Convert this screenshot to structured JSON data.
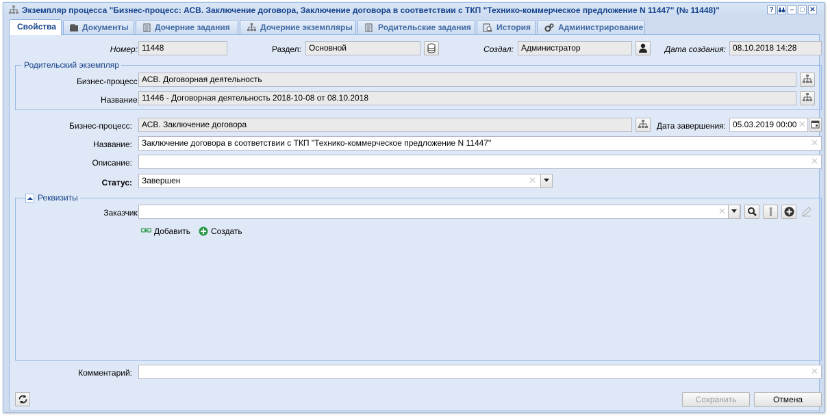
{
  "window": {
    "title": "Экземпляр процесса \"Бизнес-процесс: АСВ. Заключение договора, Заключение договора в соответствии с ТКП \"Технико-коммерческое предложение N 11447\" (№ 11448)\"",
    "buttons": [
      "?",
      "⚲",
      "–",
      "□",
      "✕"
    ]
  },
  "tabs": [
    {
      "label": "Свойства",
      "icon": "none"
    },
    {
      "label": "Документы",
      "icon": "documents-icon"
    },
    {
      "label": "Дочерние задания",
      "icon": "task-icon"
    },
    {
      "label": "Дочерние экземпляры",
      "icon": "process-icon"
    },
    {
      "label": "Родительские задания",
      "icon": "task-icon"
    },
    {
      "label": "История",
      "icon": "history-icon"
    },
    {
      "label": "Администрирование",
      "icon": "gear-icon"
    }
  ],
  "header": {
    "number_label": "Номер:",
    "number_value": "11448",
    "section_label": "Раздел:",
    "section_value": "Основной",
    "created_by_label": "Создал:",
    "created_by_value": "Администратор",
    "created_date_label": "Дата создания:",
    "created_date_value": "08.10.2018 14:28"
  },
  "parent": {
    "legend": "Родительский экземпляр",
    "bp_label": "Бизнес-процесс:",
    "bp_value": "АСВ. Договорная деятельность",
    "name_label": "Название:",
    "name_value": "11446 - Договорная деятельность 2018-10-08 от 08.10.2018"
  },
  "main": {
    "bp_label": "Бизнес-процесс:",
    "bp_value": "АСВ. Заключение договора",
    "end_date_label": "Дата завершения:",
    "end_date_value": "05.03.2019 00:00",
    "name_label": "Название:",
    "name_value": "Заключение договора в соответствии с ТКП \"Технико-коммерческое предложение N 11447\"",
    "description_label": "Описание:",
    "description_value": "",
    "status_label": "Статус:",
    "status_value": "Завершен"
  },
  "requisites": {
    "legend": "Реквизиты",
    "customer_label": "Заказчик:",
    "customer_value": "",
    "add_label": "Добавить",
    "create_label": "Создать"
  },
  "footer": {
    "comment_label": "Комментарий:",
    "comment_value": "",
    "save_label": "Сохранить",
    "cancel_label": "Отмена"
  },
  "colors": {
    "title": "#15428b",
    "panel": "#dfe8f6",
    "border": "#99bbe8",
    "create": "#2e9b4a"
  }
}
